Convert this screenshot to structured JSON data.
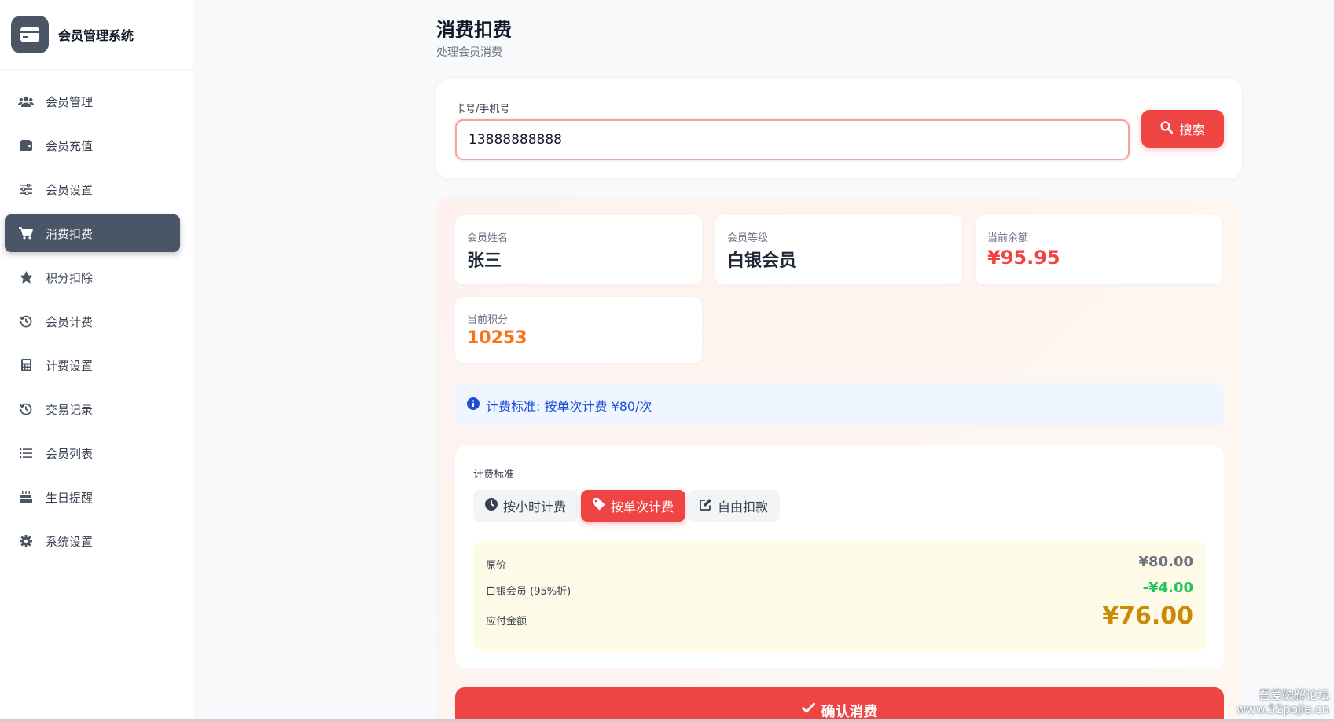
{
  "app": {
    "title": "会员管理系统",
    "logo_icon": "credit-card-icon"
  },
  "sidebar": {
    "items": [
      {
        "label": "会员管理",
        "icon": "users-icon",
        "active": false
      },
      {
        "label": "会员充值",
        "icon": "wallet-icon",
        "active": false
      },
      {
        "label": "会员设置",
        "icon": "sliders-icon",
        "active": false
      },
      {
        "label": "消费扣费",
        "icon": "cart-icon",
        "active": true
      },
      {
        "label": "积分扣除",
        "icon": "star-icon",
        "active": false
      },
      {
        "label": "会员计费",
        "icon": "history-icon",
        "active": false
      },
      {
        "label": "计费设置",
        "icon": "calculator-icon",
        "active": false
      },
      {
        "label": "交易记录",
        "icon": "history-icon",
        "active": false
      },
      {
        "label": "会员列表",
        "icon": "list-icon",
        "active": false
      },
      {
        "label": "生日提醒",
        "icon": "cake-icon",
        "active": false
      },
      {
        "label": "系统设置",
        "icon": "gear-icon",
        "active": false
      }
    ]
  },
  "page": {
    "title": "消费扣费",
    "subtitle": "处理会员消费"
  },
  "search": {
    "label": "卡号/手机号",
    "value": "13888888888",
    "button_label": "搜索"
  },
  "member": {
    "name_label": "会员姓名",
    "name": "张三",
    "level_label": "会员等级",
    "level": "白银会员",
    "balance_label": "当前余额",
    "balance": "¥95.95",
    "points_label": "当前积分",
    "points": "10253"
  },
  "notice": {
    "text": "计费标准: 按单次计费 ¥80/次"
  },
  "billing": {
    "label": "计费标准",
    "modes": [
      {
        "label": "按小时计费",
        "icon": "clock-icon",
        "active": false
      },
      {
        "label": "按单次计费",
        "icon": "tag-icon",
        "active": true
      },
      {
        "label": "自由扣款",
        "icon": "edit-icon",
        "active": false
      }
    ]
  },
  "pricing": {
    "original_label": "原价",
    "original_value": "¥80.00",
    "discount_label": "白银会员 (95%折)",
    "discount_value": "-¥4.00",
    "payable_label": "应付金额",
    "payable_value": "¥76.00"
  },
  "confirm": {
    "label": "确认消费"
  },
  "watermark": {
    "line1": "吾爱破解论坛",
    "line2": "www.52pojie.cn"
  },
  "colors": {
    "accent": "#ef4444",
    "sidebar_active": "#4a5568",
    "green": "#22c55e",
    "gold": "#ca8a04",
    "orange": "#f97316",
    "info": "#1d4ed8"
  }
}
